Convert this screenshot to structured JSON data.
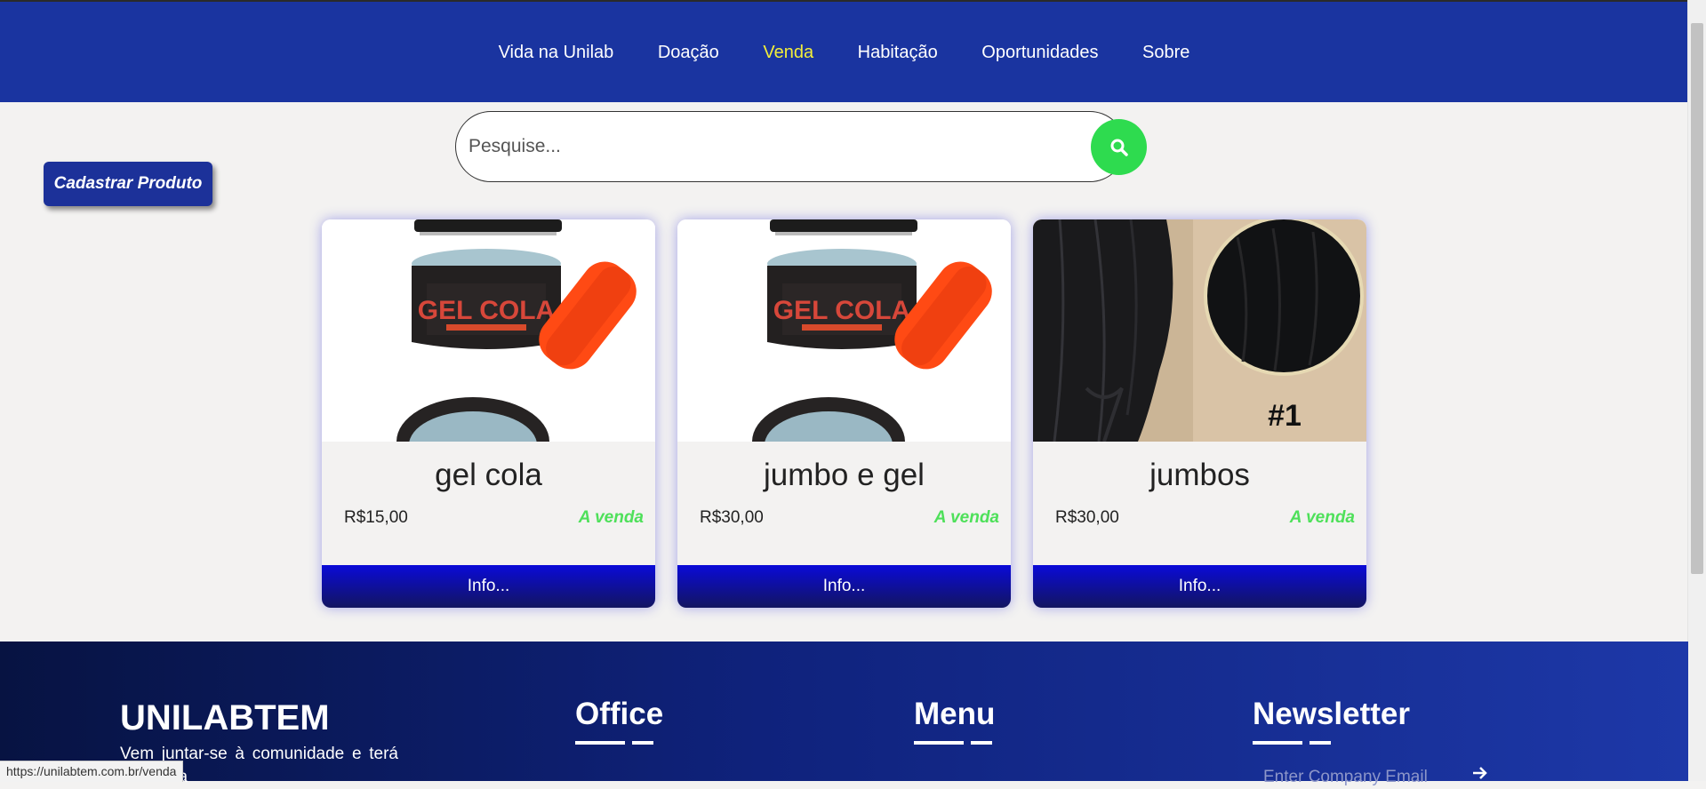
{
  "nav": {
    "items": [
      "Vida na Unilab",
      "Doação",
      "Venda",
      "Habitação",
      "Oportunidades",
      "Sobre"
    ],
    "active_index": 2
  },
  "search": {
    "placeholder": "Pesquise...",
    "icon": "search-icon"
  },
  "cadastrar_label": "Cadastrar Produto",
  "products": [
    {
      "title": "gel cola",
      "price": "R$15,00",
      "status": "A venda",
      "info_label": "Info...",
      "image": "gel-cola-jar"
    },
    {
      "title": "jumbo e gel",
      "price": "R$30,00",
      "status": "A venda",
      "info_label": "Info...",
      "image": "gel-cola-jar"
    },
    {
      "title": "jumbos",
      "price": "R$30,00",
      "status": "A venda",
      "info_label": "Info...",
      "image": "black-hair-braids"
    }
  ],
  "footer": {
    "brand": "UNILABTEM",
    "description": "Vem juntar-se à comunidade e terá acesso a",
    "columns": [
      "Office",
      "Menu",
      "Newsletter"
    ],
    "newsletter_placeholder": "Enter Company Email"
  },
  "status_url": "https://unilabtem.com.br/venda",
  "colors": {
    "header_bg": "#1a34a0",
    "active_nav": "#f2ee3a",
    "search_button": "#2edb4f",
    "status_green": "#4ee05a",
    "info_button": "#0a0ad8"
  }
}
